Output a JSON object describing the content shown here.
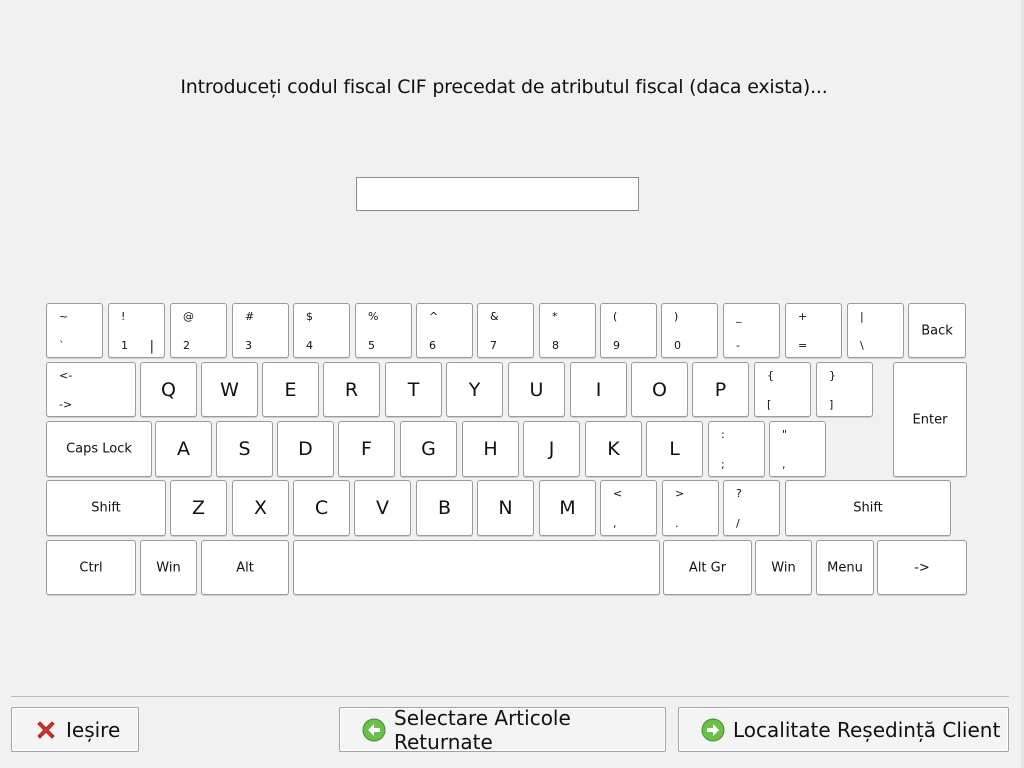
{
  "prompt": "Introduceți codul fiscal CIF precedat de atributul fiscal (daca exista)...",
  "cif_input": {
    "value": "",
    "placeholder": ""
  },
  "keyboard": {
    "keys": [
      {
        "name": "key-tilde",
        "shift": "~",
        "base": "`"
      },
      {
        "name": "key-1",
        "shift": "!",
        "base": "1",
        "extra": "|"
      },
      {
        "name": "key-2",
        "shift": "@",
        "base": "2"
      },
      {
        "name": "key-3",
        "shift": "#",
        "base": "3"
      },
      {
        "name": "key-4",
        "shift": "$",
        "base": "4"
      },
      {
        "name": "key-5",
        "shift": "%",
        "base": "5"
      },
      {
        "name": "key-6",
        "shift": "^",
        "base": "6"
      },
      {
        "name": "key-7",
        "shift": "&",
        "base": "7"
      },
      {
        "name": "key-8",
        "shift": "*",
        "base": "8"
      },
      {
        "name": "key-9",
        "shift": "(",
        "base": "9"
      },
      {
        "name": "key-0",
        "shift": ")",
        "base": "0"
      },
      {
        "name": "key-minus",
        "shift": "_",
        "base": "-"
      },
      {
        "name": "key-equals",
        "shift": "+",
        "base": "="
      },
      {
        "name": "key-backslash",
        "shift": "|",
        "base": "\\"
      },
      {
        "name": "key-back",
        "label": "Back"
      },
      {
        "name": "key-tab",
        "shift": "<-",
        "base": "->"
      },
      {
        "name": "key-q",
        "big": "Q"
      },
      {
        "name": "key-w",
        "big": "W"
      },
      {
        "name": "key-e",
        "big": "E"
      },
      {
        "name": "key-r",
        "big": "R"
      },
      {
        "name": "key-t",
        "big": "T"
      },
      {
        "name": "key-y",
        "big": "Y"
      },
      {
        "name": "key-u",
        "big": "U"
      },
      {
        "name": "key-i",
        "big": "I"
      },
      {
        "name": "key-o",
        "big": "O"
      },
      {
        "name": "key-p",
        "big": "P"
      },
      {
        "name": "key-bracket-left",
        "shift": "{",
        "base": "["
      },
      {
        "name": "key-bracket-right",
        "shift": "}",
        "base": "]"
      },
      {
        "name": "key-enter",
        "label": "Enter"
      },
      {
        "name": "key-caps-lock",
        "label": "Caps Lock"
      },
      {
        "name": "key-a",
        "big": "A"
      },
      {
        "name": "key-s",
        "big": "S"
      },
      {
        "name": "key-d",
        "big": "D"
      },
      {
        "name": "key-f",
        "big": "F"
      },
      {
        "name": "key-g",
        "big": "G"
      },
      {
        "name": "key-h",
        "big": "H"
      },
      {
        "name": "key-j",
        "big": "J"
      },
      {
        "name": "key-k",
        "big": "K"
      },
      {
        "name": "key-l",
        "big": "L"
      },
      {
        "name": "key-semicolon",
        "shift": ":",
        "base": ";"
      },
      {
        "name": "key-quote",
        "shift": "\"",
        "base": ","
      },
      {
        "name": "key-shift-left",
        "label": "Shift"
      },
      {
        "name": "key-z",
        "big": "Z"
      },
      {
        "name": "key-x",
        "big": "X"
      },
      {
        "name": "key-c",
        "big": "C"
      },
      {
        "name": "key-v",
        "big": "V"
      },
      {
        "name": "key-b",
        "big": "B"
      },
      {
        "name": "key-n",
        "big": "N"
      },
      {
        "name": "key-m",
        "big": "M"
      },
      {
        "name": "key-comma",
        "shift": "<",
        "base": ","
      },
      {
        "name": "key-period",
        "shift": ">",
        "base": "."
      },
      {
        "name": "key-slash",
        "shift": "?",
        "base": "/"
      },
      {
        "name": "key-shift-right",
        "label": "Shift"
      },
      {
        "name": "key-ctrl",
        "label": "Ctrl"
      },
      {
        "name": "key-win-left",
        "label": "Win"
      },
      {
        "name": "key-alt",
        "label": "Alt"
      },
      {
        "name": "key-space",
        "label": ""
      },
      {
        "name": "key-alt-gr",
        "label": "Alt Gr"
      },
      {
        "name": "key-win-right",
        "label": "Win"
      },
      {
        "name": "key-menu",
        "label": "Menu"
      },
      {
        "name": "key-arrow-right",
        "label": "->"
      }
    ]
  },
  "buttons": {
    "exit": {
      "label": "Ieșire",
      "icon": "red-x-icon",
      "color": "#d9342b"
    },
    "returns": {
      "label": "Selectare Articole Returnate",
      "icon": "green-arrow-left-icon",
      "color": "#6cc04a"
    },
    "locality": {
      "label": "Localitate Reședință Client",
      "icon": "green-arrow-right-icon",
      "color": "#6cc04a"
    }
  }
}
